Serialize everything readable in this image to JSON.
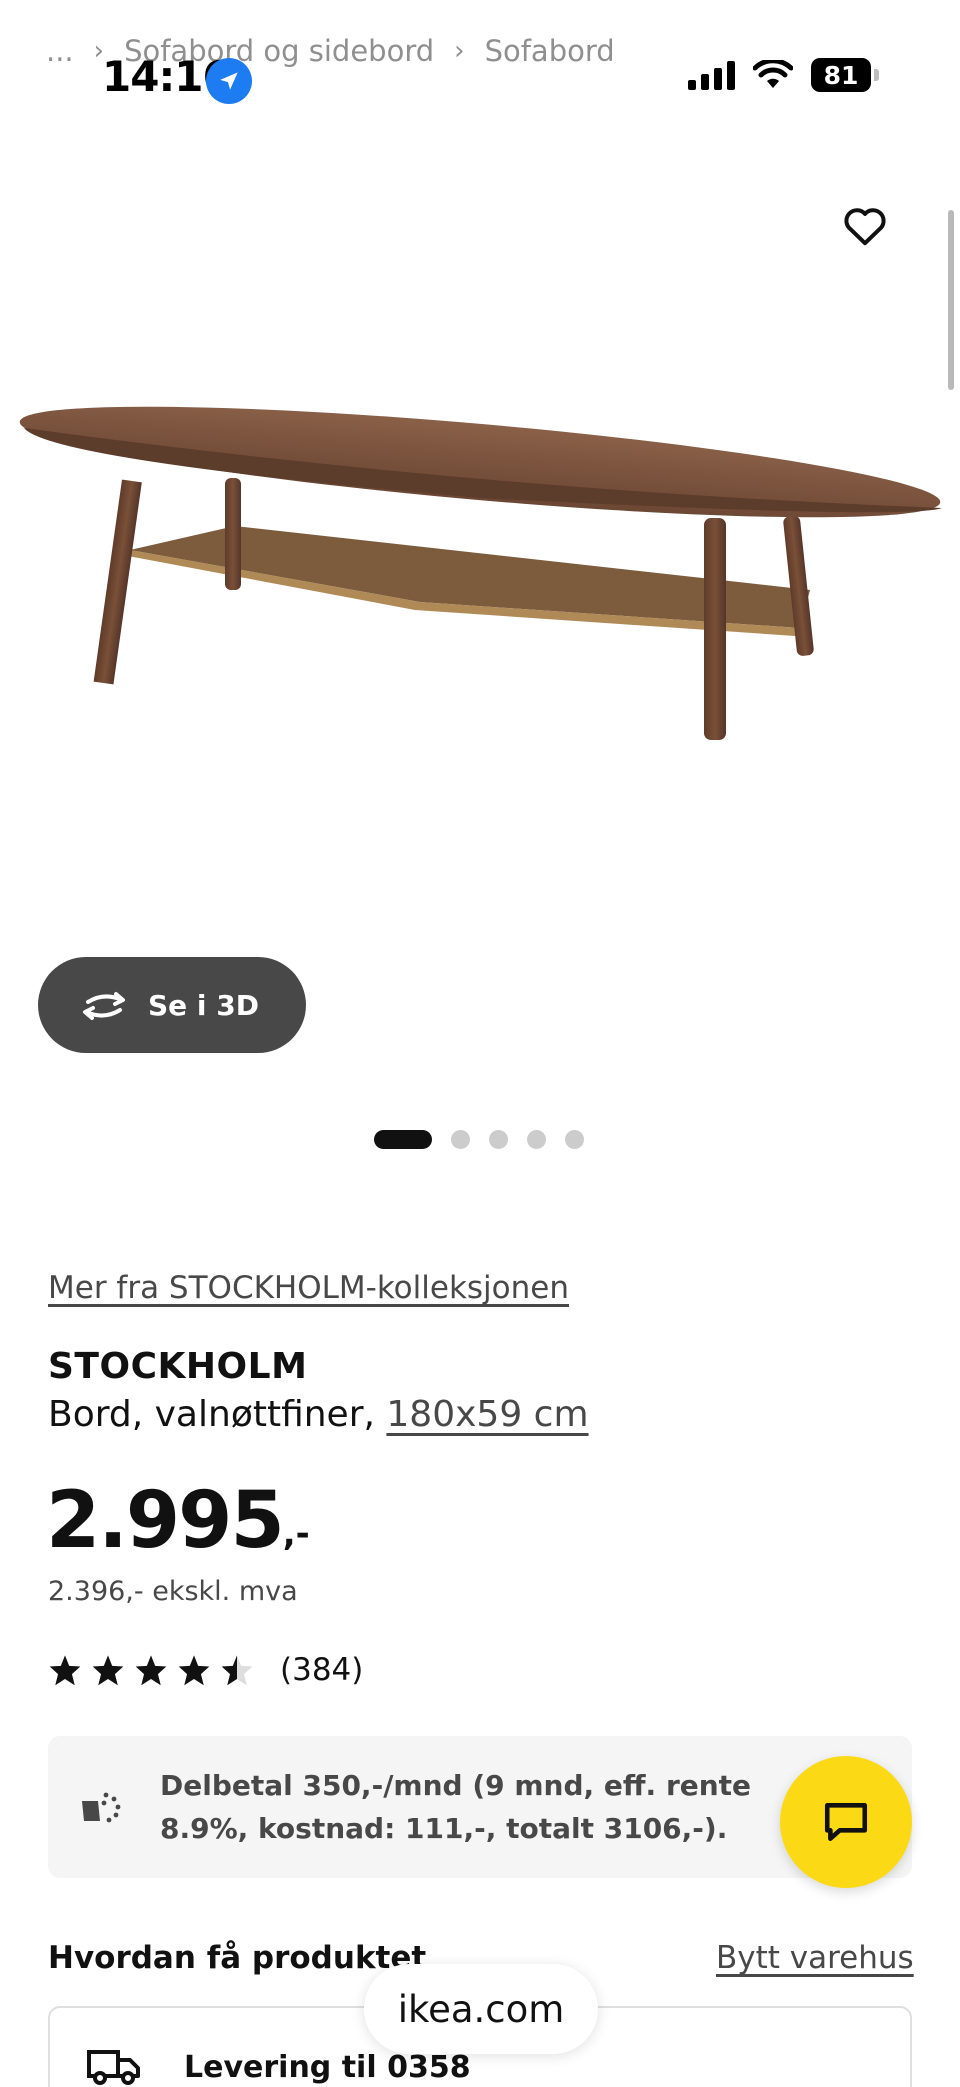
{
  "status_bar": {
    "time": "14:16",
    "battery": "81"
  },
  "breadcrumb": {
    "ellipsis": "...",
    "items": [
      "Sofabord og sidebord",
      "Sofabord"
    ]
  },
  "gallery": {
    "view_3d_label": "Se i 3D",
    "dot_count": 5,
    "active_index": 0
  },
  "product": {
    "collection_link": "Mer fra STOCKHOLM-kolleksjonen",
    "name": "STOCKHOLM",
    "description": "Bord, valnøttfiner,",
    "size": "180x59 cm",
    "price": "2.995",
    "price_suffix": ",-",
    "price_ex_vat": "2.396,- ekskl. mva",
    "rating": 4.5,
    "rating_count": "(384)"
  },
  "installment": {
    "text": "Delbetal 350,-/mnd (9 mnd, eff. rente 8.9%, kostnad: 111,-, totalt 3106,-)."
  },
  "delivery": {
    "title": "Hvordan få produktet",
    "change_store": "Bytt varehus",
    "option_title": "Levering til 0358"
  },
  "browser": {
    "url": "ikea.com"
  },
  "colors": {
    "accent_yellow": "#fbd914",
    "dark_button": "#484848",
    "location_blue": "#1e7cf2",
    "text_primary": "#111111",
    "text_secondary": "#484848"
  },
  "icons": {
    "wishlist": "heart-icon",
    "rotate": "rotate-3d-icon",
    "chat": "chat-icon",
    "installment": "payment-icon",
    "delivery": "truck-icon"
  }
}
